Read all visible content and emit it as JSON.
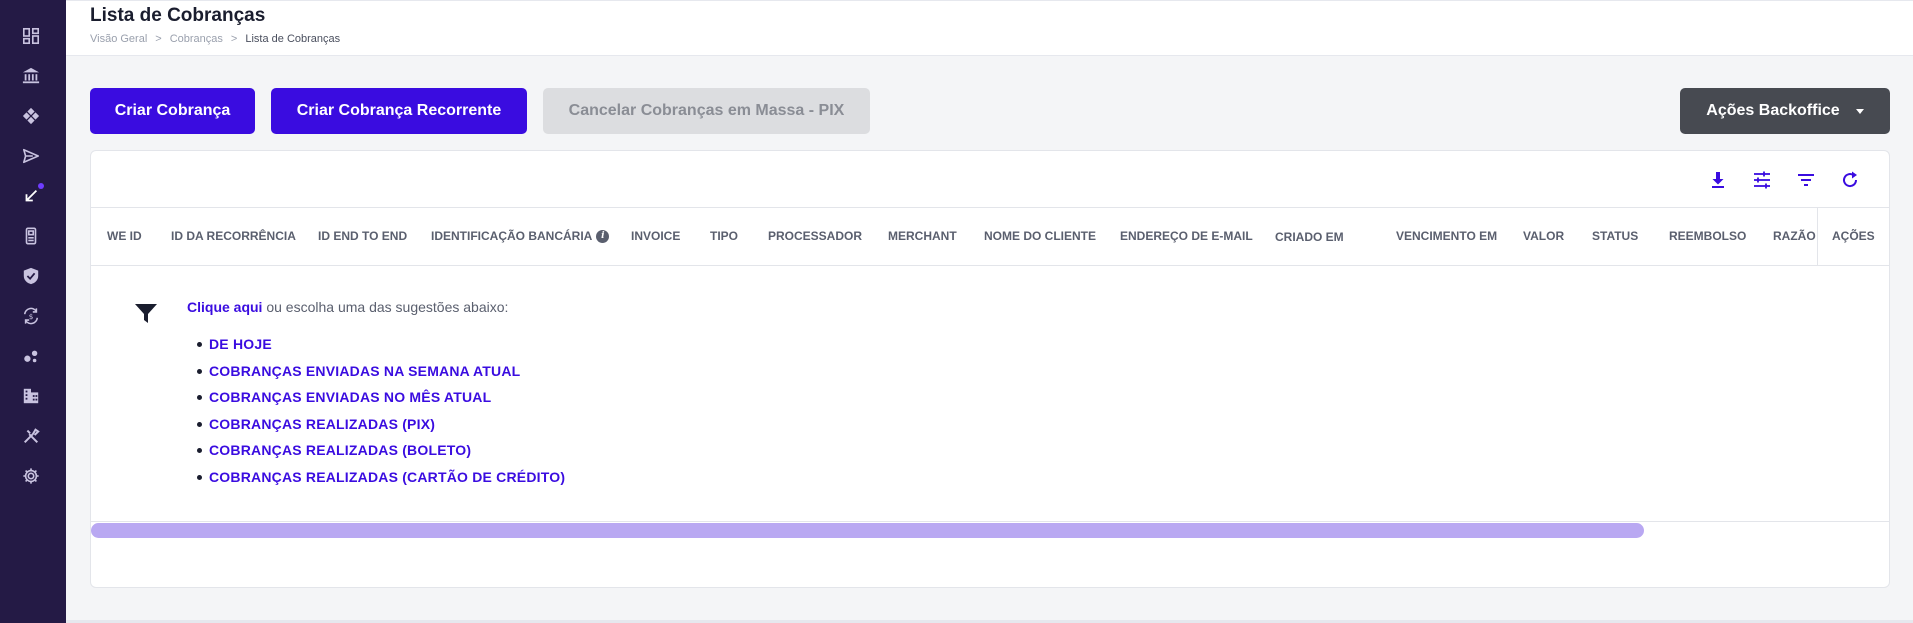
{
  "header": {
    "title": "Lista de Cobranças",
    "breadcrumb": [
      "Visão Geral",
      "Cobranças",
      "Lista de Cobranças"
    ],
    "separator": ">"
  },
  "actions": {
    "create_charge": "Criar Cobrança",
    "create_recurring": "Criar Cobrança Recorrente",
    "cancel_mass_pix": "Cancelar Cobranças em Massa - PIX",
    "backoffice": "Ações Backoffice"
  },
  "table": {
    "columns": [
      "WE ID",
      "ID DA RECORRÊNCIA",
      "ID END TO END",
      "IDENTIFICAÇÃO BANCÁRIA",
      "INVOICE",
      "TIPO",
      "PROCESSADOR",
      "MERCHANT",
      "NOME DO CLIENTE",
      "ENDEREÇO DE E-MAIL",
      "CRIADO EM",
      "VENCIMENTO EM",
      "VALOR",
      "STATUS",
      "REEMBOLSO",
      "RAZÃO I"
    ],
    "actions_column": "AÇÕES",
    "info_glyph": "i"
  },
  "empty_state": {
    "link_text": "Clique aqui",
    "rest_text": " ou escolha uma das sugestões abaixo:",
    "suggestions": [
      "DE HOJE",
      "COBRANÇAS ENVIADAS NA SEMANA ATUAL",
      "COBRANÇAS ENVIADAS NO MÊS ATUAL",
      "COBRANÇAS REALIZADAS (PIX)",
      "COBRANÇAS REALIZADAS (BOLETO)",
      "COBRANÇAS REALIZADAS (CARTÃO DE CRÉDITO)"
    ]
  },
  "sidebar": {
    "icons": [
      "dashboard-icon",
      "bank-icon",
      "cubes-icon",
      "send-icon",
      "receive-icon",
      "pos-terminal-icon",
      "shield-check-icon",
      "currency-exchange-icon",
      "bubbles-icon",
      "building-icon",
      "tools-icon",
      "gear-icon"
    ]
  },
  "toolbar": {
    "icons": [
      "download-icon",
      "tune-icon",
      "filter-lines-icon",
      "refresh-icon"
    ]
  },
  "colors": {
    "sidebar_bg": "#241a45",
    "primary": "#3a0ce0",
    "disabled": "#dcdde0",
    "dark_button": "#474a51",
    "scroll_thumb": "#b9a8f2"
  }
}
